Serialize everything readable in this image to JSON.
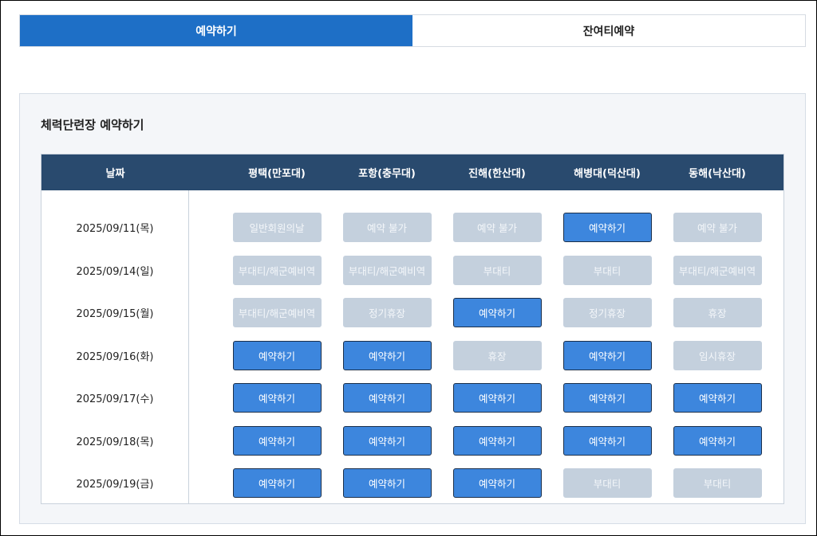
{
  "tabs": [
    {
      "label": "예약하기",
      "active": true
    },
    {
      "label": "잔여티예약",
      "active": false
    }
  ],
  "panel": {
    "title": "체력단련장 예약하기"
  },
  "table": {
    "header_date": "날짜",
    "columns": [
      "평택(만포대)",
      "포항(충무대)",
      "진해(한산대)",
      "해병대(덕산대)",
      "동해(낙산대)"
    ],
    "rows": [
      {
        "date": "2025/09/11(목)",
        "cells": [
          {
            "label": "일반회원의날",
            "available": false
          },
          {
            "label": "예약 불가",
            "available": false
          },
          {
            "label": "예약 불가",
            "available": false
          },
          {
            "label": "예약하기",
            "available": true
          },
          {
            "label": "예약 불가",
            "available": false
          }
        ]
      },
      {
        "date": "2025/09/14(일)",
        "cells": [
          {
            "label": "부대티/해군예비역",
            "available": false
          },
          {
            "label": "부대티/해군예비역",
            "available": false
          },
          {
            "label": "부대티",
            "available": false
          },
          {
            "label": "부대티",
            "available": false
          },
          {
            "label": "부대티/해군예비역",
            "available": false
          }
        ]
      },
      {
        "date": "2025/09/15(월)",
        "cells": [
          {
            "label": "부대티/해군예비역",
            "available": false
          },
          {
            "label": "정기휴장",
            "available": false
          },
          {
            "label": "예약하기",
            "available": true
          },
          {
            "label": "정기휴장",
            "available": false
          },
          {
            "label": "휴장",
            "available": false
          }
        ]
      },
      {
        "date": "2025/09/16(화)",
        "cells": [
          {
            "label": "예약하기",
            "available": true
          },
          {
            "label": "예약하기",
            "available": true
          },
          {
            "label": "휴장",
            "available": false
          },
          {
            "label": "예약하기",
            "available": true
          },
          {
            "label": "임시휴장",
            "available": false
          }
        ]
      },
      {
        "date": "2025/09/17(수)",
        "cells": [
          {
            "label": "예약하기",
            "available": true
          },
          {
            "label": "예약하기",
            "available": true
          },
          {
            "label": "예약하기",
            "available": true
          },
          {
            "label": "예약하기",
            "available": true
          },
          {
            "label": "예약하기",
            "available": true
          }
        ]
      },
      {
        "date": "2025/09/18(목)",
        "cells": [
          {
            "label": "예약하기",
            "available": true
          },
          {
            "label": "예약하기",
            "available": true
          },
          {
            "label": "예약하기",
            "available": true
          },
          {
            "label": "예약하기",
            "available": true
          },
          {
            "label": "예약하기",
            "available": true
          }
        ]
      },
      {
        "date": "2025/09/19(금)",
        "cells": [
          {
            "label": "예약하기",
            "available": true
          },
          {
            "label": "예약하기",
            "available": true
          },
          {
            "label": "예약하기",
            "available": true
          },
          {
            "label": "부대티",
            "available": false
          },
          {
            "label": "부대티",
            "available": false
          }
        ]
      }
    ]
  },
  "colors": {
    "tab_active": "#1e6fc6",
    "header_bg": "#294a6e",
    "button_on": "#3d86dd",
    "button_off": "#c4d0dd"
  }
}
